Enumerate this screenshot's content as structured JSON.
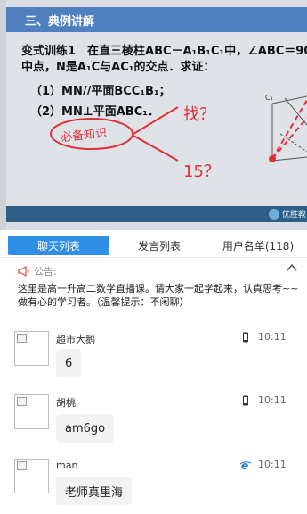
{
  "slide": {
    "title": "三、典例讲解",
    "problem_line1": "变式训练1　在直三棱柱ABC－A₁B₁C₁中，∠ABC＝90",
    "problem_line2": "中点，N是A₁C与AC₁的交点．求证：",
    "part1": "（1）MN//平面BCC₁B₁；",
    "part2": "（2）MN⊥平面ABC₁．",
    "annotation_circle": "必备知识",
    "annotation_1": "找？",
    "annotation_2": "15？",
    "vertex_label": "C₁",
    "logo_text": "优胜教"
  },
  "tabs": [
    {
      "label": "聊天列表",
      "active": true
    },
    {
      "label": "发言列表",
      "active": false
    },
    {
      "label": "用户名单(118)",
      "active": false
    }
  ],
  "notice": {
    "title": "公告:",
    "text": "这里是高一升高二数学直播课。请大家一起学起来，认真思考~~做有心的学习者。（温馨提示：不闲聊）"
  },
  "messages": [
    {
      "user": "超市大鹅",
      "device": "mobile-icon",
      "time": "10:11",
      "text": "6"
    },
    {
      "user": "胡桃",
      "device": "mobile-icon",
      "time": "10:11",
      "text": "am6go"
    },
    {
      "user": "man",
      "device": "ie-browser-icon",
      "time": "10:11",
      "text": "老师真里海"
    }
  ],
  "colors": {
    "slide_header": "#4f7fbf",
    "active_tab": "#2f8ee5",
    "annotation": "#e0303a",
    "video_bar": "#2d5f86"
  }
}
